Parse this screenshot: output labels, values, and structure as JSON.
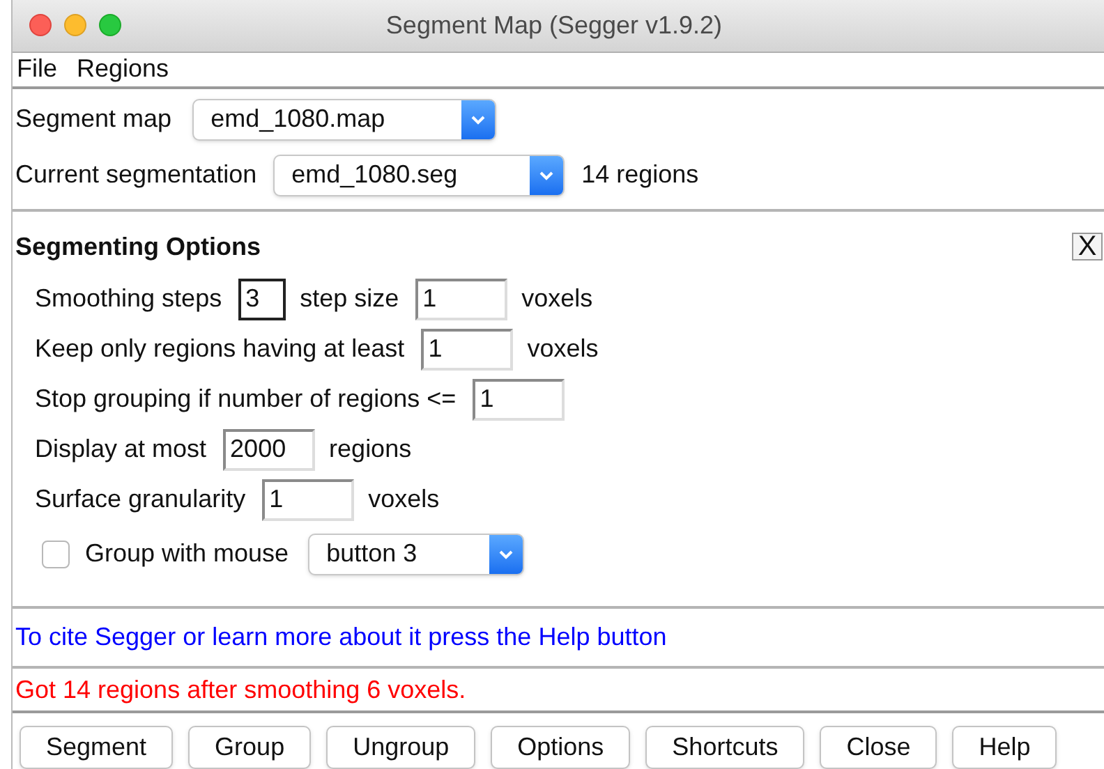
{
  "window": {
    "title": "Segment Map (Segger v1.9.2)"
  },
  "menu": [
    "File",
    "Regions"
  ],
  "segment_map": {
    "label": "Segment map",
    "value": "emd_1080.map"
  },
  "current_segmentation": {
    "label": "Current segmentation",
    "value": "emd_1080.seg",
    "count": "14 regions"
  },
  "options_panel": {
    "title": "Segmenting Options",
    "close": "X",
    "rows": [
      {
        "parts": [
          {
            "kind": "label",
            "text": "Smoothing steps"
          },
          {
            "kind": "narrow_field",
            "value": "3",
            "focused": true
          },
          {
            "kind": "label",
            "text": "step size"
          },
          {
            "kind": "field",
            "value": "1",
            "focused": false
          },
          {
            "kind": "label",
            "text": "voxels"
          }
        ]
      },
      {
        "parts": [
          {
            "kind": "label",
            "text": "Keep only regions having at least"
          },
          {
            "kind": "field",
            "value": "1",
            "focused": false
          },
          {
            "kind": "label",
            "text": "voxels"
          }
        ]
      },
      {
        "parts": [
          {
            "kind": "label",
            "text": "Stop grouping if number of regions <="
          },
          {
            "kind": "field",
            "value": "1",
            "focused": false
          }
        ]
      },
      {
        "parts": [
          {
            "kind": "label",
            "text": "Display at most"
          },
          {
            "kind": "field",
            "value": "2000",
            "focused": false
          },
          {
            "kind": "label",
            "text": "regions"
          }
        ]
      },
      {
        "parts": [
          {
            "kind": "label",
            "text": "Surface granularity"
          },
          {
            "kind": "field",
            "value": "1",
            "focused": false
          },
          {
            "kind": "label",
            "text": "voxels"
          }
        ]
      }
    ],
    "group_with_mouse": {
      "label": "Group with mouse",
      "checked": false,
      "value": "button 3"
    }
  },
  "cite_message": "To cite Segger or learn more about it press the Help button",
  "status_message": "Got 14 regions after smoothing 6 voxels.",
  "buttons": [
    "Segment",
    "Group",
    "Ungroup",
    "Options",
    "Shortcuts",
    "Close",
    "Help"
  ]
}
